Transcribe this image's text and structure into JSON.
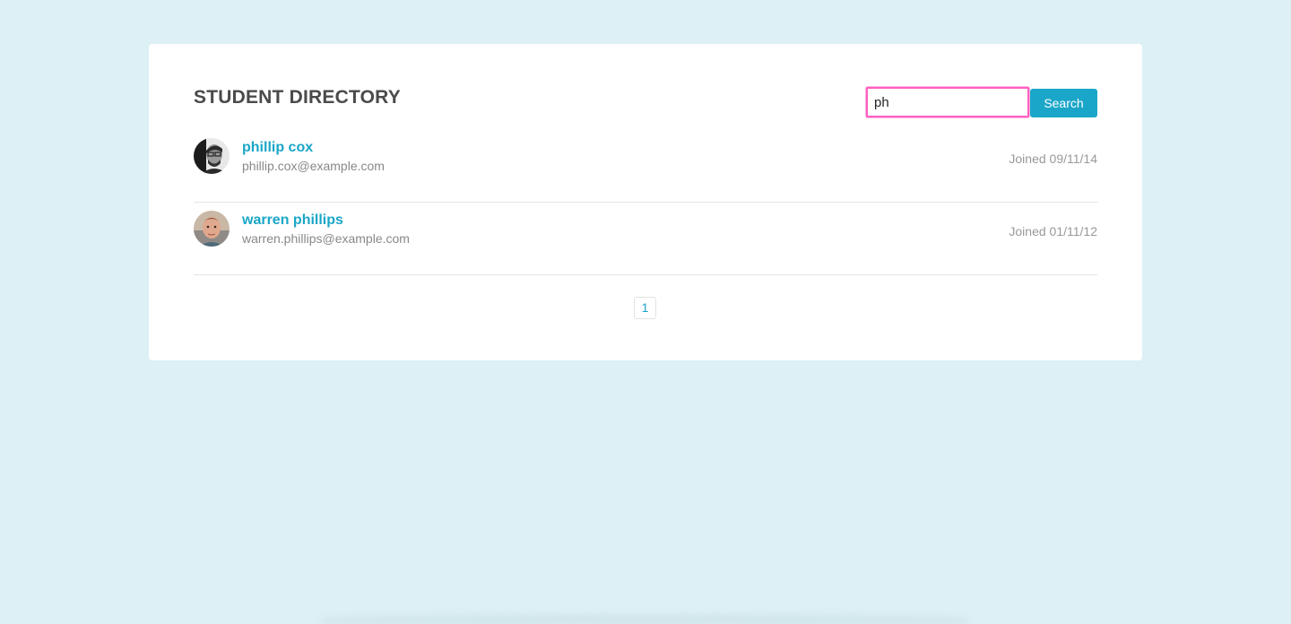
{
  "directory": {
    "title": "STUDENT DIRECTORY"
  },
  "search": {
    "value": "ph",
    "placeholder": "",
    "button_label": "Search"
  },
  "students": [
    {
      "name": "phillip cox",
      "email": "phillip.cox@example.com",
      "joined": "Joined 09/11/14",
      "avatar_icon": "person-photo-icon"
    },
    {
      "name": "warren phillips",
      "email": "warren.phillips@example.com",
      "joined": "Joined 01/11/12",
      "avatar_icon": "person-photo-icon"
    }
  ],
  "pagination": {
    "pages": [
      "1"
    ]
  },
  "colors": {
    "background": "#dcf0f5",
    "accent": "#1aa6c8",
    "focus_outline": "#ff5fc0"
  }
}
